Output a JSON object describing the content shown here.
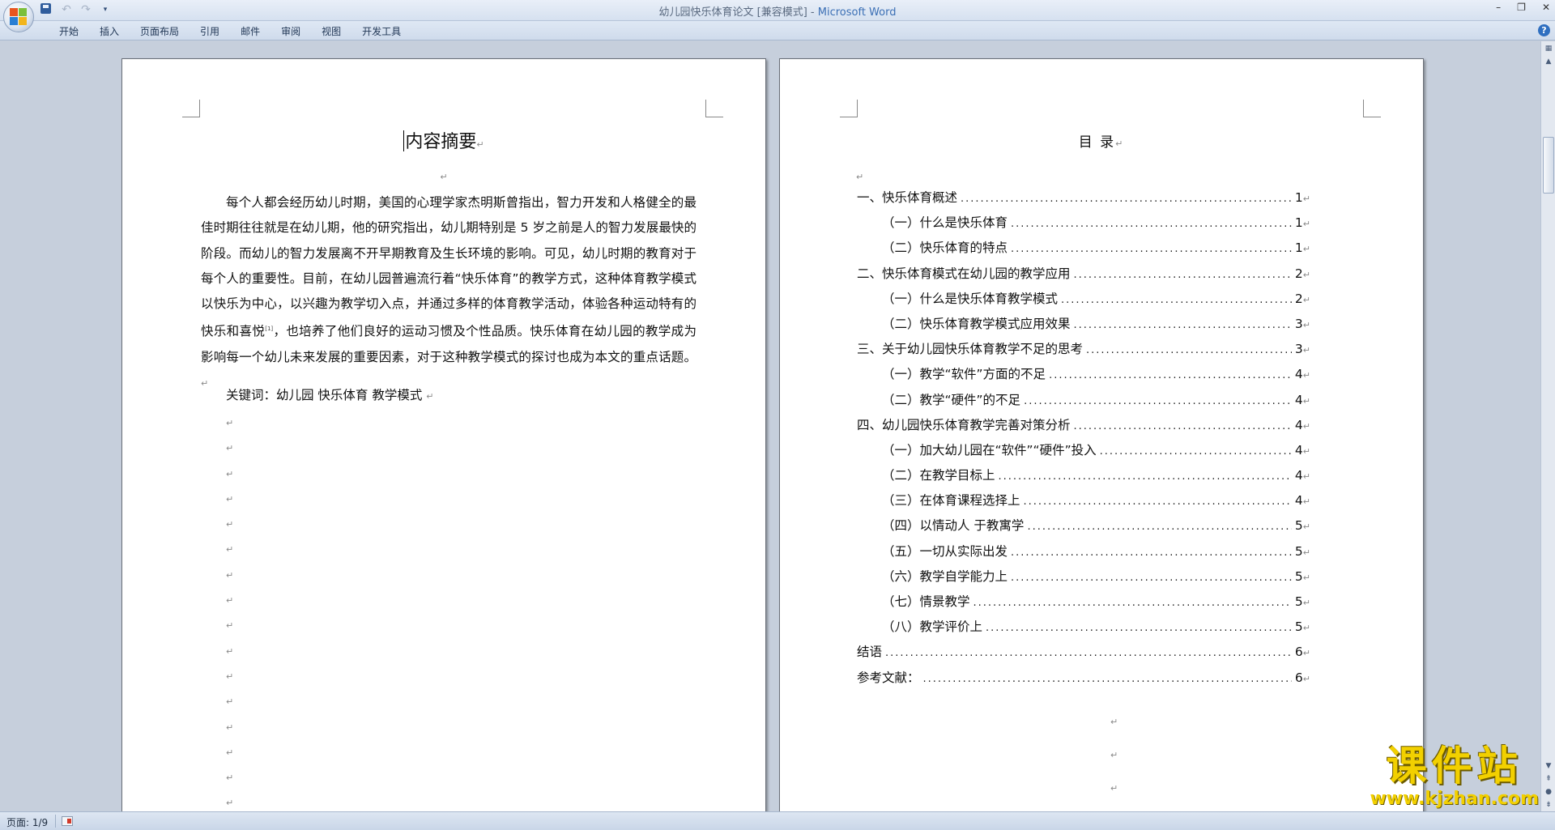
{
  "window": {
    "title_doc": "幼儿园快乐体育论文 [兼容模式] - ",
    "title_app": "Microsoft Word",
    "controls": [
      "–",
      "❐",
      "✕"
    ]
  },
  "qat": {
    "save_icon": "save-icon",
    "undo": "↶",
    "redo": "↷",
    "more": "▾"
  },
  "ribbon": {
    "tabs": [
      "开始",
      "插入",
      "页面布局",
      "引用",
      "邮件",
      "审阅",
      "视图",
      "开发工具"
    ],
    "help": "?"
  },
  "page1": {
    "title": "内容摘要",
    "return_mark": "↵",
    "body_part1": "每个人都会经历幼儿时期，美国的心理学家杰明斯曾指出，智力开发和人格健全的最佳时期往往就是在幼儿期，他的研究指出，幼儿期特别是 5 岁之前是人的智力发展最快的阶段。而幼儿的智力发展离不开早期教育及生长环境的影响。可见，幼儿时期的教育对于每个人的重要性。目前，在幼儿园普遍流行着“快乐体育”的教学方式，这种体育教学模式以快乐为中心，以兴趣为教学切入点，并通过多样的体育教学活动，体验各种运动特有的快乐和喜悦",
    "citation": "[1]",
    "body_part2": "，也培养了他们良好的运动习惯及个性品质。快乐体育在幼儿园的教学成为影响每一个幼儿未来发展的重要因素，对于这种教学模式的探讨也成为本文的重点话题。",
    "keywords": "关键词：幼儿园 快乐体育  教学模式 ",
    "empty_lines": 16
  },
  "page2": {
    "title": "目  录",
    "return_mark": "↵",
    "toc": [
      {
        "label": "一、快乐体育概述",
        "page": "1",
        "level": 1
      },
      {
        "label": "（一）什么是快乐体育",
        "page": "1",
        "level": 2
      },
      {
        "label": "（二）快乐体育的特点",
        "page": "1",
        "level": 2
      },
      {
        "label": "二、快乐体育模式在幼儿园的教学应用",
        "page": "2",
        "level": 1
      },
      {
        "label": "（一）什么是快乐体育教学模式",
        "page": "2",
        "level": 2
      },
      {
        "label": "（二）快乐体育教学模式应用效果",
        "page": "3",
        "level": 2
      },
      {
        "label": "三、关于幼儿园快乐体育教学不足的思考",
        "page": "3",
        "level": 1
      },
      {
        "label": "（一）教学“软件”方面的不足",
        "page": "4",
        "level": 2
      },
      {
        "label": "（二）教学“硬件”的不足",
        "page": "4",
        "level": 2
      },
      {
        "label": "四、幼儿园快乐体育教学完善对策分析",
        "page": "4",
        "level": 1
      },
      {
        "label": "（一）加大幼儿园在“软件”“硬件”投入",
        "page": "4",
        "level": 2
      },
      {
        "label": "（二）在教学目标上",
        "page": "4",
        "level": 2
      },
      {
        "label": "（三）在体育课程选择上",
        "page": "4",
        "level": 2
      },
      {
        "label": "（四）以情动人  于教寓学",
        "page": "5",
        "level": 2
      },
      {
        "label": "（五）一切从实际出发",
        "page": "5",
        "level": 2
      },
      {
        "label": "（六）教学自学能力上",
        "page": "5",
        "level": 2
      },
      {
        "label": "（七）情景教学",
        "page": "5",
        "level": 2
      },
      {
        "label": "（八）教学评价上",
        "page": "5",
        "level": 2
      },
      {
        "label": "结语",
        "page": "6",
        "level": 1
      },
      {
        "label": "参考文献：",
        "page": "6",
        "level": 1
      }
    ],
    "empty_lines": 4
  },
  "status": {
    "page": "页面: 1/9"
  },
  "watermark": {
    "cn": "课件站",
    "url": "www.kjzhan.com"
  }
}
